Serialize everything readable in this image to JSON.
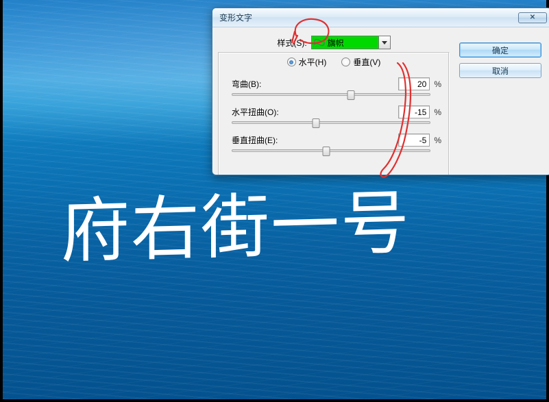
{
  "dialog": {
    "title": "变形文字",
    "close_x": "✕",
    "style_label": "样式(S):",
    "style_selected": "旗帜",
    "orientation": {
      "horizontal_label": "水平(H)",
      "vertical_label": "垂直(V)",
      "selected": "horizontal"
    },
    "sliders": {
      "bend": {
        "label": "弯曲(B):",
        "value": "20",
        "unit": "%",
        "pos": 60
      },
      "hdist": {
        "label": "水平扭曲(O):",
        "value": "-15",
        "unit": "%",
        "pos": 42.5
      },
      "vdist": {
        "label": "垂直扭曲(E):",
        "value": "-5",
        "unit": "%",
        "pos": 47.5
      }
    },
    "buttons": {
      "ok": "确定",
      "cancel": "取消"
    }
  },
  "canvas": {
    "warped_text": "府右街一号"
  }
}
